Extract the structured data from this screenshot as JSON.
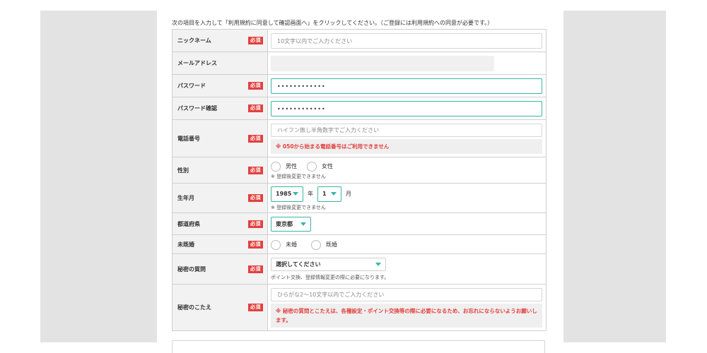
{
  "intro": "次の項目を入力して「利用規約に同意して確認画面へ」をクリックしてください。（ご登録には利用規約への同意が必要です。）",
  "required_badge": "必須",
  "fields": {
    "nickname": {
      "label": "ニックネーム",
      "placeholder": "10文字以内でご入力ください"
    },
    "email": {
      "label": "メールアドレス"
    },
    "password": {
      "label": "パスワード",
      "value": "••••••••••••"
    },
    "password_confirm": {
      "label": "パスワード確認",
      "value": "••••••••••••"
    },
    "phone": {
      "label": "電話番号",
      "placeholder": "ハイフン無し半角数字でご入力ください",
      "warning": "※ 050から始まる電話番号はご利用できません"
    },
    "gender": {
      "label": "性別",
      "options": [
        "男性",
        "女性"
      ],
      "note": "※ 登録後変更できません"
    },
    "birth": {
      "label": "生年月",
      "year": "1985",
      "year_unit": "年",
      "month": "1",
      "month_unit": "月",
      "note": "※ 登録後変更できません"
    },
    "prefecture": {
      "label": "都道府県",
      "value": "東京都"
    },
    "marital": {
      "label": "未既婚",
      "options": [
        "未婚",
        "既婚"
      ]
    },
    "secret_question": {
      "label": "秘密の質問",
      "value": "選択してください",
      "note": "ポイント交換、登録情報変更の際に必要になります。"
    },
    "secret_answer": {
      "label": "秘密のこたえ",
      "placeholder": "ひらがな2〜10文字以内でご入力ください",
      "warning": "※ 秘密の質問とこたえは、各種設定・ポイント交換等の際に必要になるため、お忘れにならないようお願いします。"
    }
  },
  "colors": {
    "accent": "#39b5a8",
    "required": "#e2403e"
  }
}
